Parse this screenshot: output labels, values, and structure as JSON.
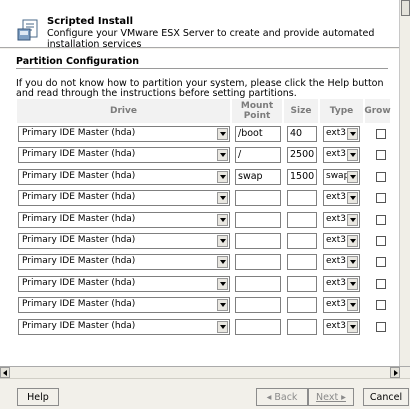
{
  "header": {
    "title": "Scripted Install",
    "description": "Configure your VMware ESX Server to create and provide automated installation services"
  },
  "section": {
    "title": "Partition Configuration",
    "instructions": "If you do not know how to partition your system, please click the Help button and read through the instructions before setting partitions."
  },
  "columns": {
    "drive": "Drive",
    "mount_point": "Mount Point",
    "size": "Size",
    "type": "Type",
    "grow": "Grow"
  },
  "rows": [
    {
      "drive": "Primary IDE Master (hda)",
      "mount": "/boot",
      "size": "40",
      "type": "ext3",
      "grow": false
    },
    {
      "drive": "Primary IDE Master (hda)",
      "mount": "/",
      "size": "2500",
      "type": "ext3",
      "grow": false
    },
    {
      "drive": "Primary IDE Master (hda)",
      "mount": "swap",
      "size": "1500",
      "type": "swap",
      "grow": false
    },
    {
      "drive": "Primary IDE Master (hda)",
      "mount": "",
      "size": "",
      "type": "ext3",
      "grow": false
    },
    {
      "drive": "Primary IDE Master (hda)",
      "mount": "",
      "size": "",
      "type": "ext3",
      "grow": false
    },
    {
      "drive": "Primary IDE Master (hda)",
      "mount": "",
      "size": "",
      "type": "ext3",
      "grow": false
    },
    {
      "drive": "Primary IDE Master (hda)",
      "mount": "",
      "size": "",
      "type": "ext3",
      "grow": false
    },
    {
      "drive": "Primary IDE Master (hda)",
      "mount": "",
      "size": "",
      "type": "ext3",
      "grow": false
    },
    {
      "drive": "Primary IDE Master (hda)",
      "mount": "",
      "size": "",
      "type": "ext3",
      "grow": false
    },
    {
      "drive": "Primary IDE Master (hda)",
      "mount": "",
      "size": "",
      "type": "ext3",
      "grow": false
    }
  ],
  "footer": {
    "help_label": "Help",
    "back_label": "◂ Back",
    "next_label": "Next ▸",
    "cancel_label": "Cancel"
  },
  "icons": {
    "header": "install-script-icon"
  }
}
